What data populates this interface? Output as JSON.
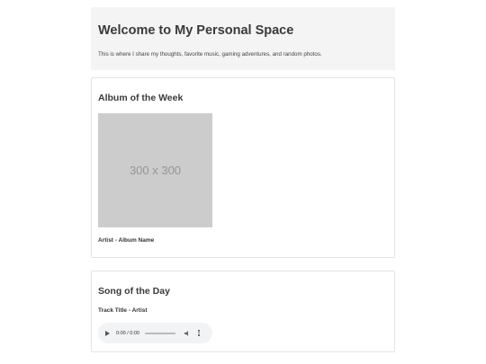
{
  "header": {
    "title": "Welcome to My Personal Space",
    "intro": "This is where I share my thoughts, favorite music, gaming adventures, and random photos."
  },
  "album_of_week": {
    "heading": "Album of the Week",
    "placeholder_text": "300 x 300",
    "caption": "Artist - Album Name"
  },
  "song_of_day": {
    "heading": "Song of the Day",
    "track": "Track Title - Artist",
    "player": {
      "time": "0:00 / 0:00",
      "progress": 0,
      "icons": [
        "play-icon",
        "volume-icon",
        "more-options-icon"
      ]
    }
  }
}
